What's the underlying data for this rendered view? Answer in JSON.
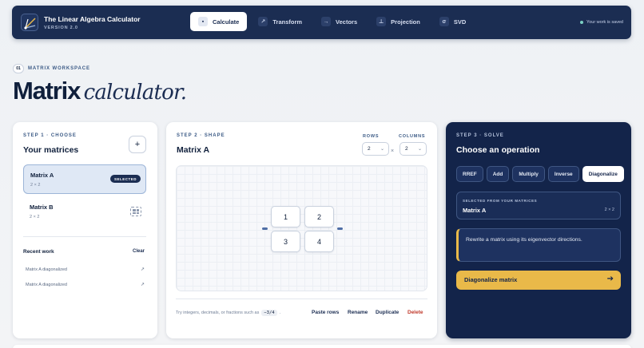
{
  "app": {
    "title": "The Linear Algebra Calculator",
    "version": "VERSION 2.0",
    "saved_status": "Your work is saved"
  },
  "nav": {
    "tabs": [
      {
        "label": "Calculate",
        "icon": "square-dot-icon",
        "glyph": "▪",
        "active": true
      },
      {
        "label": "Transform",
        "icon": "arrow-up-right-icon",
        "glyph": "↗",
        "active": false
      },
      {
        "label": "Vectors",
        "icon": "arrow-right-icon",
        "glyph": "→",
        "active": false
      },
      {
        "label": "Projection",
        "icon": "perpendicular-icon",
        "glyph": "⊥",
        "active": false
      },
      {
        "label": "SVD",
        "icon": "sigma-icon",
        "glyph": "σ",
        "active": false
      }
    ]
  },
  "heading": {
    "step_number": "01",
    "section_label": "MATRIX WORKSPACE",
    "title_strong": "Matrix",
    "title_light": "calculator."
  },
  "step1": {
    "step_label": "STEP 1 · CHOOSE",
    "title": "Your matrices",
    "add_glyph": "+",
    "matrices": [
      {
        "name": "Matrix A",
        "dims": "2 × 2",
        "badge": "SELECTED",
        "selected": true
      },
      {
        "name": "Matrix B",
        "dims": "2 × 2",
        "selected": false
      }
    ],
    "recent_label": "Recent work",
    "clear_label": "Clear",
    "recent": [
      {
        "label": "Matrix A diagonalized",
        "arrow": "↗"
      },
      {
        "label": "Matrix A diagonalized",
        "arrow": "↗"
      }
    ]
  },
  "step2": {
    "step_label": "STEP 2 · SHAPE",
    "title": "Matrix A",
    "rows_label": "ROWS",
    "columns_label": "COLUMNS",
    "rows_value": "2",
    "columns_value": "2",
    "times": "×",
    "cells": [
      "1",
      "2",
      "3",
      "4"
    ],
    "hint_prefix": "Try integers, decimals, or fractions such as",
    "hint_code": "−3/4",
    "hint_suffix": ".",
    "actions": {
      "paste": "Paste rows",
      "rename": "Rename",
      "duplicate": "Duplicate",
      "delete": "Delete"
    }
  },
  "step3": {
    "step_label": "STEP 3 · SOLVE",
    "title": "Choose an operation",
    "operations": [
      {
        "label": "RREF",
        "active": false
      },
      {
        "label": "Add",
        "active": false
      },
      {
        "label": "Multiply",
        "active": false
      },
      {
        "label": "Inverse",
        "active": false
      },
      {
        "label": "Diagonalize",
        "active": true
      }
    ],
    "selected_label": "SELECTED FROM YOUR MATRICES",
    "selected_name": "Matrix A",
    "selected_dims": "2 × 2",
    "description": "Rewrite a matrix using its eigenvector directions.",
    "run_label": "Diagonalize matrix",
    "run_arrow": "➔"
  },
  "colors": {
    "navy": "#1b2d52",
    "panel_dark": "#13244a",
    "accent_gold": "#e9b949",
    "danger": "#c0392b"
  }
}
